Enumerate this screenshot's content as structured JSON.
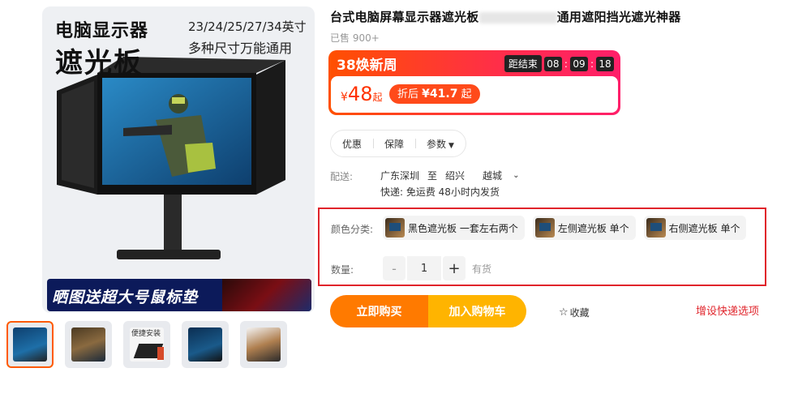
{
  "gallery": {
    "hero_line_1": "电脑显示器",
    "hero_line_2": "遮光板",
    "hero_sizes": "23/24/25/27/34英寸",
    "hero_tagline": "多种尺寸万能通用",
    "promo_banner": "晒图送超大号鼠标垫",
    "thumbnails": [
      {
        "name": "thumb-1",
        "active": true
      },
      {
        "name": "thumb-2",
        "active": false
      },
      {
        "name": "thumb-3",
        "active": false
      },
      {
        "name": "thumb-4",
        "active": false
      },
      {
        "name": "thumb-5",
        "active": false
      }
    ],
    "thumb_3_label": "便捷安装"
  },
  "product": {
    "title_prefix": "台式电脑屏幕显示器遮光板",
    "title_suffix": "通用遮阳挡光遮光神器",
    "sold": "已售 900+"
  },
  "promo": {
    "name": "38焕新周",
    "countdown_label": "距结束",
    "hours": "08",
    "minutes": "09",
    "seconds": "18",
    "sep": ":",
    "currency": "¥",
    "price": "48",
    "price_suffix": "起",
    "after_discount_label": "折后",
    "after_discount_price": "¥41.7",
    "after_discount_suffix": "起"
  },
  "tabs": [
    {
      "label": "优惠"
    },
    {
      "label": "保障"
    },
    {
      "label": "参数"
    }
  ],
  "shipping": {
    "label": "配送:",
    "from": "广东深圳",
    "to_word": "至",
    "to_city": "绍兴",
    "to_district": "越城",
    "note": "快递: 免运费  48小时内发货"
  },
  "sku": {
    "color_label": "颜色分类:",
    "options": [
      {
        "label": "黑色遮光板 一套左右两个"
      },
      {
        "label": "左侧遮光板 单个"
      },
      {
        "label": "右侧遮光板 单个"
      }
    ],
    "qty_label": "数量:",
    "qty_minus": "-",
    "qty_value": "1",
    "qty_plus": "+",
    "stock": "有货"
  },
  "actions": {
    "buy_now": "立即购买",
    "add_cart": "加入购物车",
    "favorite": "收藏",
    "red_note": "增设快递选项"
  },
  "colors": {
    "accent_orange": "#ff5000",
    "red_outline": "#e0242b",
    "buy_button": "#ff7a00",
    "cart_button": "#ffb400"
  }
}
